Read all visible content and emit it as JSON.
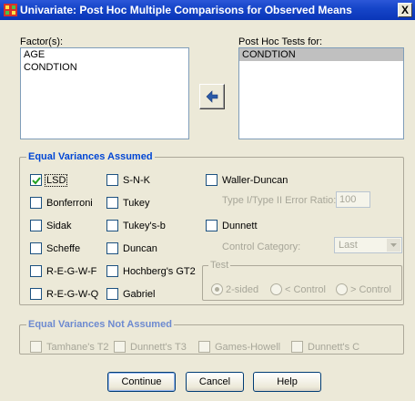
{
  "window": {
    "title": "Univariate: Post Hoc Multiple Comparisons for Observed Means",
    "close_glyph": "X"
  },
  "factors": {
    "label": "Factor(s):",
    "items": [
      "AGE",
      "CONDTION"
    ]
  },
  "post_hoc": {
    "label": "Post Hoc Tests for:",
    "items": [
      "CONDTION"
    ]
  },
  "equal_assumed": {
    "title": "Equal Variances Assumed",
    "col1": [
      {
        "label": "LSD",
        "checked": true
      },
      {
        "label": "Bonferroni",
        "checked": false
      },
      {
        "label": "Sidak",
        "checked": false
      },
      {
        "label": "Scheffe",
        "checked": false
      },
      {
        "label": "R-E-G-W-F",
        "checked": false
      },
      {
        "label": "R-E-G-W-Q",
        "checked": false
      }
    ],
    "col2": [
      {
        "label": "S-N-K",
        "checked": false
      },
      {
        "label": "Tukey",
        "checked": false
      },
      {
        "label": "Tukey's-b",
        "checked": false
      },
      {
        "label": "Duncan",
        "checked": false
      },
      {
        "label": "Hochberg's GT2",
        "checked": false
      },
      {
        "label": "Gabriel",
        "checked": false
      }
    ],
    "waller": {
      "label": "Waller-Duncan",
      "checked": false
    },
    "ratio_label": "Type I/Type II Error Ratio:",
    "ratio_value": "100",
    "dunnett": {
      "label": "Dunnett",
      "checked": false
    },
    "control_label": "Control Category:",
    "control_value": "Last",
    "test": {
      "title": "Test",
      "options": [
        "2-sided",
        "< Control",
        "> Control"
      ]
    }
  },
  "not_assumed": {
    "title": "Equal Variances Not Assumed",
    "items": [
      "Tamhane's T2",
      "Dunnett's T3",
      "Games-Howell",
      "Dunnett's C"
    ]
  },
  "buttons": {
    "continue": "Continue",
    "cancel": "Cancel",
    "help": "Help"
  },
  "colors": {
    "titlebar": "#0a36b8",
    "group_title": "#0046d5",
    "disabled_text": "#a7a699"
  }
}
